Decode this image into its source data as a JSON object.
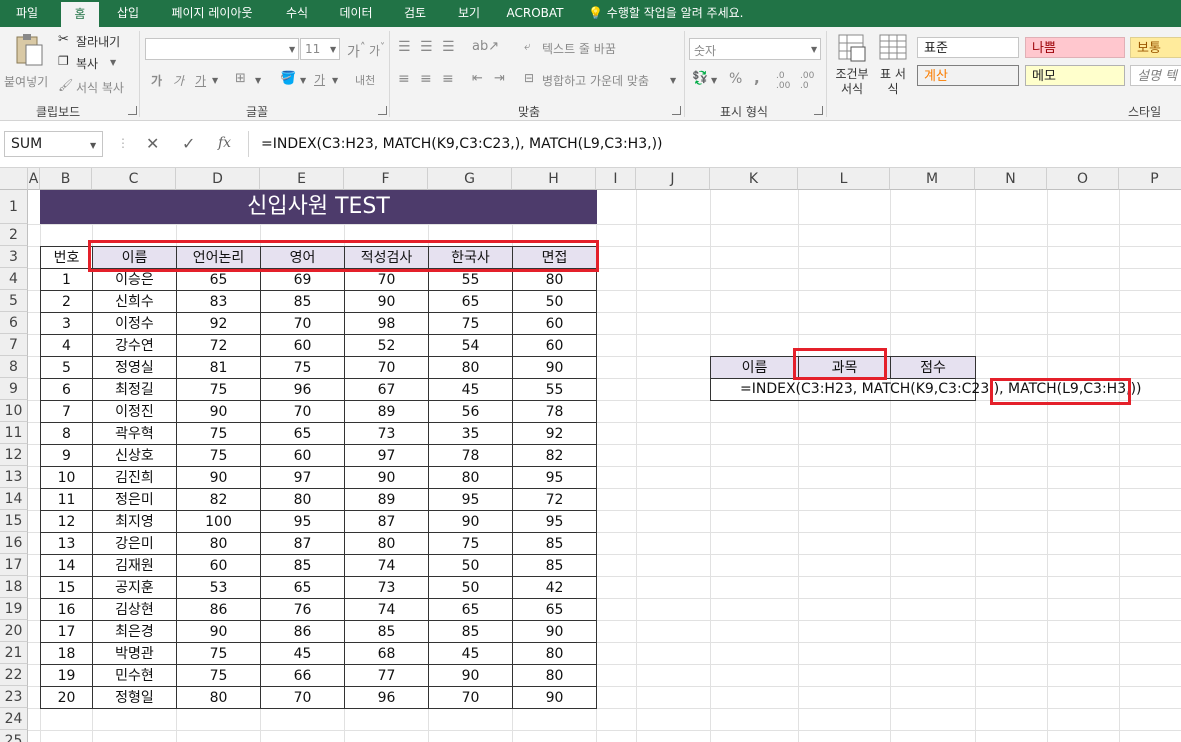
{
  "ribbon": {
    "tabs": [
      "파일",
      "홈",
      "삽입",
      "페이지 레이아웃",
      "수식",
      "데이터",
      "검토",
      "보기",
      "ACROBAT"
    ],
    "active_tab": "홈",
    "tell_me": "수행할 작업을 알려 주세요.",
    "clipboard": {
      "paste": "붙여넣기",
      "cut": "잘라내기",
      "copy": "복사",
      "format_painter": "서식 복사",
      "label": "클립보드"
    },
    "font": {
      "font_name": "",
      "font_size": "11",
      "label": "글꼴",
      "bold": "가",
      "italic": "가",
      "underline": "가",
      "phonetic": "내천"
    },
    "alignment": {
      "wrap_text": "텍스트 줄 바꿈",
      "merge_center": "병합하고 가운데 맞춤",
      "label": "맞춤"
    },
    "number": {
      "format": "숫자",
      "percent": "%",
      "comma": ",",
      "label": "표시 형식"
    },
    "styles": {
      "conditional": "조건부 서식",
      "table_format": "표 서식",
      "cells": [
        "표준",
        "나쁨",
        "보통",
        "계산",
        "메모",
        "설명 텍"
      ],
      "label": "스타일"
    }
  },
  "formula_bar": {
    "name_box": "SUM",
    "cancel_icon": "✕",
    "enter_icon": "✓",
    "fx": "fx",
    "formula": "=INDEX(C3:H23, MATCH(K9,C3:C23,), MATCH(L9,C3:H3,))"
  },
  "sheet": {
    "columns": [
      "A",
      "B",
      "C",
      "D",
      "E",
      "F",
      "G",
      "H",
      "I",
      "J",
      "K",
      "L",
      "M",
      "N",
      "O",
      "P"
    ],
    "rows": [
      "1",
      "2",
      "3",
      "4",
      "5",
      "6",
      "7",
      "8",
      "9",
      "10",
      "11",
      "12",
      "13",
      "14",
      "15",
      "16",
      "17",
      "18",
      "19",
      "20",
      "21",
      "22",
      "23",
      "24",
      "25"
    ],
    "title": "신입사원 TEST",
    "table_headers": [
      "번호",
      "이름",
      "언어논리",
      "영어",
      "적성검사",
      "한국사",
      "면접"
    ],
    "table_rows": [
      [
        "1",
        "이승은",
        "65",
        "69",
        "70",
        "55",
        "80"
      ],
      [
        "2",
        "신희수",
        "83",
        "85",
        "90",
        "65",
        "50"
      ],
      [
        "3",
        "이정수",
        "92",
        "70",
        "98",
        "75",
        "60"
      ],
      [
        "4",
        "강수연",
        "72",
        "60",
        "52",
        "54",
        "60"
      ],
      [
        "5",
        "정영실",
        "81",
        "75",
        "70",
        "80",
        "90"
      ],
      [
        "6",
        "최정길",
        "75",
        "96",
        "67",
        "45",
        "55"
      ],
      [
        "7",
        "이정진",
        "90",
        "70",
        "89",
        "56",
        "78"
      ],
      [
        "8",
        "곽우혁",
        "75",
        "65",
        "73",
        "35",
        "92"
      ],
      [
        "9",
        "신상호",
        "75",
        "60",
        "97",
        "78",
        "82"
      ],
      [
        "10",
        "김진희",
        "90",
        "97",
        "90",
        "80",
        "95"
      ],
      [
        "11",
        "정은미",
        "82",
        "80",
        "89",
        "95",
        "72"
      ],
      [
        "12",
        "최지영",
        "100",
        "95",
        "87",
        "90",
        "95"
      ],
      [
        "13",
        "강은미",
        "80",
        "87",
        "80",
        "75",
        "85"
      ],
      [
        "14",
        "김재원",
        "60",
        "85",
        "74",
        "50",
        "85"
      ],
      [
        "15",
        "공지훈",
        "53",
        "65",
        "73",
        "50",
        "42"
      ],
      [
        "16",
        "김상현",
        "86",
        "76",
        "74",
        "65",
        "65"
      ],
      [
        "17",
        "최은경",
        "90",
        "86",
        "85",
        "85",
        "90"
      ],
      [
        "18",
        "박명관",
        "75",
        "45",
        "68",
        "45",
        "80"
      ],
      [
        "19",
        "민수현",
        "75",
        "66",
        "77",
        "90",
        "80"
      ],
      [
        "20",
        "정형일",
        "80",
        "70",
        "96",
        "70",
        "90"
      ]
    ],
    "lookup": {
      "headers": [
        "이름",
        "과목",
        "점수"
      ],
      "edit_text": "=INDEX(C3:H23, MATCH(K9,C3:C23,), MATCH(L9,C3:H3,))"
    }
  }
}
